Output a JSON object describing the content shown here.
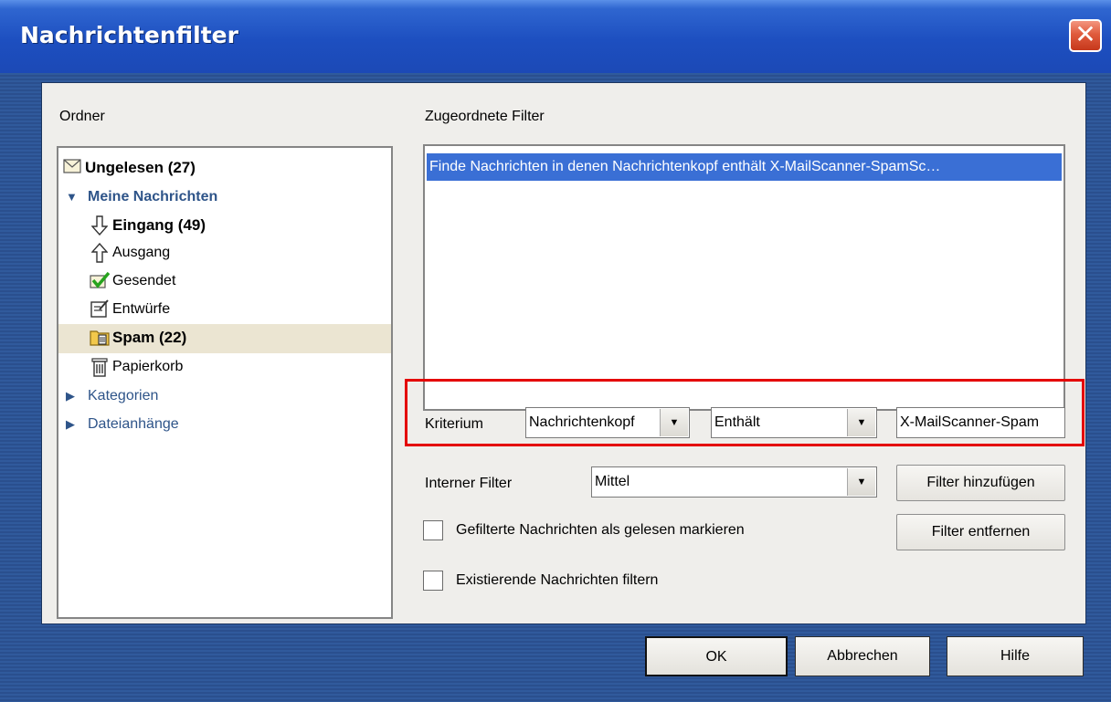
{
  "window": {
    "title": "Nachrichtenfilter",
    "close_symbol": "✕"
  },
  "folders": {
    "label": "Ordner",
    "items": [
      {
        "icon": "envelope-icon",
        "label": "Ungelesen (27)"
      },
      {
        "icon": "expand-triangle-icon",
        "label": "Meine Nachrichten"
      },
      {
        "icon": "arrow-down-icon",
        "label": "Eingang (49)"
      },
      {
        "icon": "arrow-up-icon",
        "label": "Ausgang"
      },
      {
        "icon": "checkmark-icon",
        "label": "Gesendet"
      },
      {
        "icon": "draft-icon",
        "label": "Entwürfe"
      },
      {
        "icon": "spam-icon",
        "label": "Spam (22)"
      },
      {
        "icon": "trash-icon",
        "label": "Papierkorb"
      },
      {
        "icon": "collapsed-triangle-icon",
        "label": "Kategorien"
      },
      {
        "icon": "collapsed-triangle-icon",
        "label": "Dateianhänge"
      }
    ],
    "selected": "Spam (22)"
  },
  "filters": {
    "label": "Zugeordnete Filter",
    "items": [
      "Finde Nachrichten in denen Nachrichtenkopf enthält X-MailScanner-SpamSc…"
    ]
  },
  "criterion": {
    "label": "Kriterium",
    "field": "Nachrichtenkopf",
    "operator": "Enthält",
    "value": "X-MailScanner-Spam"
  },
  "internal_filter": {
    "label": "Interner Filter",
    "value": "Mittel"
  },
  "buttons": {
    "add_filter": "Filter hinzufügen",
    "remove_filter": "Filter entfernen",
    "ok": "OK",
    "cancel": "Abbrechen",
    "help": "Hilfe"
  },
  "options": {
    "mark_read": "Gefilterte Nachrichten als gelesen markieren",
    "filter_existing": "Existierende Nachrichten filtern"
  },
  "colors": {
    "accent": "#3a6fd5",
    "highlight_frame": "#e40000",
    "nav_text": "#2e5489"
  }
}
